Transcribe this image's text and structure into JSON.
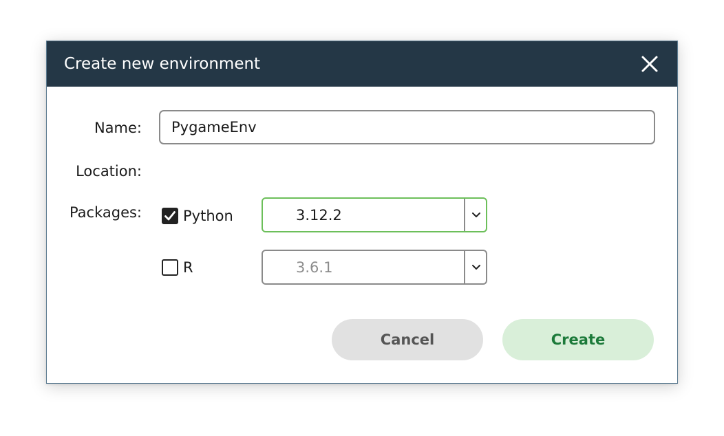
{
  "dialog": {
    "title": "Create new environment",
    "close_icon": "close-icon"
  },
  "form": {
    "name_label": "Name:",
    "name_value": "PygameEnv",
    "location_label": "Location:",
    "packages_label": "Packages:"
  },
  "packages": [
    {
      "name": "Python",
      "checked": true,
      "version": "3.12.2",
      "enabled": true
    },
    {
      "name": "R",
      "checked": false,
      "version": "3.6.1",
      "enabled": false
    }
  ],
  "buttons": {
    "cancel_label": "Cancel",
    "create_label": "Create"
  },
  "colors": {
    "titlebar": "#243746",
    "active_border": "#6cbf5a",
    "create_bg": "#d9efd9",
    "create_text": "#1c7a3a",
    "cancel_bg": "#e1e1e1",
    "cancel_text": "#555555"
  }
}
